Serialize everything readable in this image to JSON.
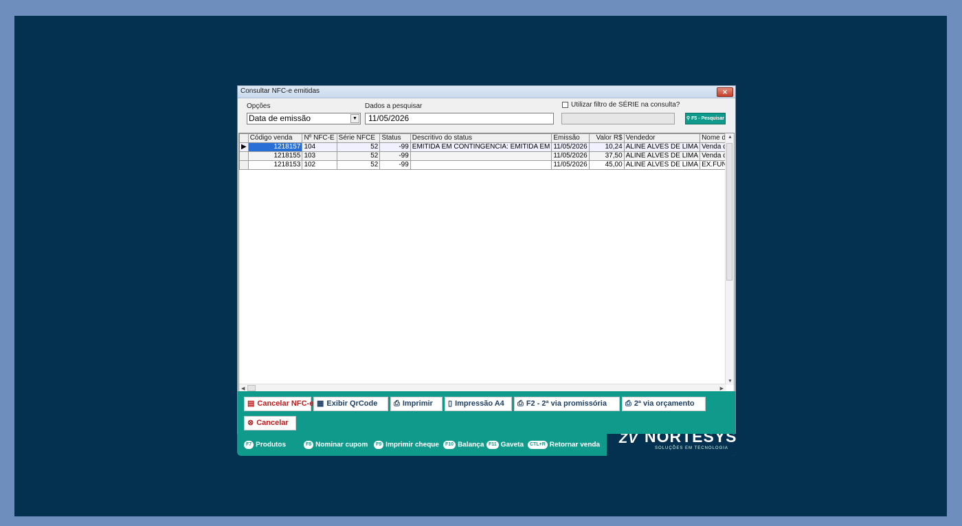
{
  "window": {
    "title": "Consultar NFC-e emitidas",
    "close_label": "✕"
  },
  "filters": {
    "opcoes_label": "Opções",
    "opcoes_value": "Data de emissão",
    "dados_label": "Dados a pesquisar",
    "dados_value": "11/05/2026",
    "serie_checkbox_label": "Utilizar filtro de SÉRIE na consulta?",
    "search_button": "F5 - Pesquisar"
  },
  "table": {
    "columns": [
      "Código venda",
      "Nº NFC-E",
      "Série NFCE",
      "Status",
      "Descritivo do status",
      "Emissão",
      "Valor R$",
      "Vendedor",
      "Nome do"
    ],
    "rows": [
      {
        "codigo": "1218157",
        "nfce": "104",
        "serie": "52",
        "status": "-99",
        "descritivo": "EMITIDA EM CONTINGENCIA: EMITIDA EM",
        "emissao": "11/05/2026",
        "valor": "10,24",
        "vendedor": "ALINE ALVES DE LIMA",
        "nome": "Venda dir"
      },
      {
        "codigo": "1218155",
        "nfce": "103",
        "serie": "52",
        "status": "-99",
        "descritivo": "",
        "emissao": "11/05/2026",
        "valor": "37,50",
        "vendedor": "ALINE ALVES DE LIMA",
        "nome": "Venda dir"
      },
      {
        "codigo": "1218153",
        "nfce": "102",
        "serie": "52",
        "status": "-99",
        "descritivo": "",
        "emissao": "11/05/2026",
        "valor": "45,00",
        "vendedor": "ALINE ALVES DE LIMA",
        "nome": "EX.FUNC"
      }
    ]
  },
  "actions": {
    "cancelar_nfce": "Cancelar NFC-e",
    "exibir_qrcode": "Exibir QrCode",
    "imprimir": "Imprimir",
    "impressao_a4": "Impressão A4",
    "f2_promissoria": "F2 - 2ª via promissória",
    "via_orcamento": "2ª via orçamento",
    "cancelar": "Cancelar"
  },
  "shortcuts": {
    "f7": {
      "key": "F7",
      "label": "Produtos"
    },
    "f8": {
      "key": "F8",
      "label": "Nominar cupom"
    },
    "f9": {
      "key": "F9",
      "label": "Imprimir cheque"
    },
    "f10": {
      "key": "F10",
      "label": "Balança"
    },
    "f11": {
      "key": "F11",
      "label": "Gaveta"
    },
    "ctlr": {
      "key": "CTL+R",
      "label": "Retornar venda"
    }
  },
  "brand": {
    "name": "NORTESYS",
    "tagline": "SOLUÇÕES EM TECNOLOGIA"
  },
  "colors": {
    "teal": "#0f9a8c",
    "navy": "#04314f",
    "border": "#6e8fbd",
    "selection": "#2a6fd6"
  }
}
